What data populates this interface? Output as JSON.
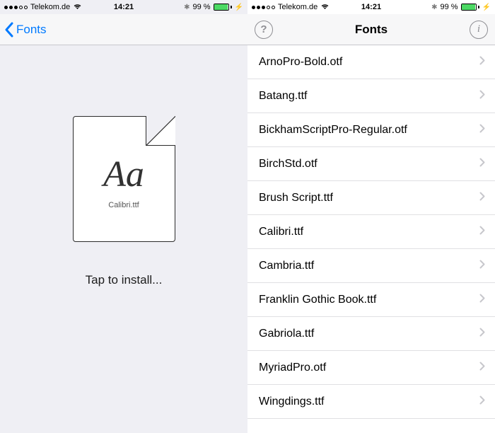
{
  "status": {
    "carrier": "Telekom.de",
    "time": "14:21",
    "battery_pct": "99 %"
  },
  "left": {
    "back_label": "Fonts",
    "file_glyph": "Aa",
    "file_name": "Calibri.ttf",
    "tap_label": "Tap to install..."
  },
  "right": {
    "title": "Fonts",
    "items": [
      {
        "label": "ArnoPro-Bold.otf"
      },
      {
        "label": "Batang.ttf"
      },
      {
        "label": "BickhamScriptPro-Regular.otf"
      },
      {
        "label": "BirchStd.otf"
      },
      {
        "label": "Brush Script.ttf"
      },
      {
        "label": "Calibri.ttf"
      },
      {
        "label": "Cambria.ttf"
      },
      {
        "label": "Franklin Gothic Book.ttf"
      },
      {
        "label": "Gabriola.ttf"
      },
      {
        "label": "MyriadPro.otf"
      },
      {
        "label": "Wingdings.ttf"
      }
    ]
  }
}
